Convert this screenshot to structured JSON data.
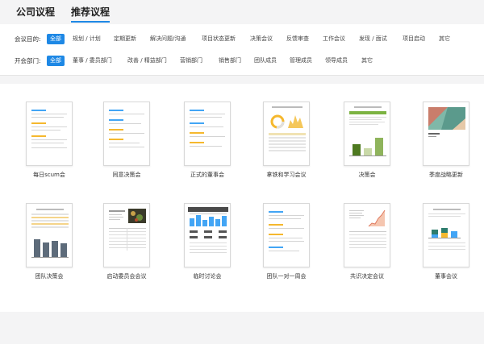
{
  "tabs": [
    "公司议程",
    "推荐议程"
  ],
  "filters": {
    "purpose": {
      "label": "会议目的:",
      "options": [
        "全部",
        "规划 / 计划",
        "定期更新",
        "解决问题/沟通",
        "项目状态更新",
        "决策会议",
        "反馈审查",
        "工作会议",
        "发现 / 面试",
        "项目启动",
        "其它"
      ]
    },
    "department": {
      "label": "开会部门:",
      "options": [
        "全部",
        "董事 / 委员部门",
        "改善 / 精益部门",
        "营销部门",
        "销售部门",
        "团队成员",
        "管理成员",
        "领导成员",
        "其它"
      ]
    }
  },
  "templates": [
    {
      "label": "每日scum会",
      "icon": "agenda-lines-thumbnail"
    },
    {
      "label": "同意决策会",
      "icon": "agenda-lines-thumbnail"
    },
    {
      "label": "正式的董事会",
      "icon": "agenda-lines-thumbnail"
    },
    {
      "label": "拿铁和学习会议",
      "icon": "donut-chart-thumbnail"
    },
    {
      "label": "决策会",
      "icon": "bar-chart-thumbnail"
    },
    {
      "label": "季度战略更新",
      "icon": "cover-image-thumbnail"
    },
    {
      "label": "团队决策会",
      "icon": "column-chart-thumbnail"
    },
    {
      "label": "启动委员会会议",
      "icon": "photo-table-thumbnail"
    },
    {
      "label": "临时讨论会",
      "icon": "kpi-table-thumbnail"
    },
    {
      "label": "团队一对一周会",
      "icon": "agenda-lines-thumbnail"
    },
    {
      "label": "共识决定会议",
      "icon": "line-chart-thumbnail"
    },
    {
      "label": "董事会议",
      "icon": "stacked-chart-thumbnail"
    }
  ],
  "colors": {
    "accent": "#1e88e5",
    "agenda_blue": "#42a5f5",
    "agenda_yellow": "#f5b82e",
    "chart_green": "#5a8a2a",
    "chart_slate": "#5d6b7a"
  }
}
